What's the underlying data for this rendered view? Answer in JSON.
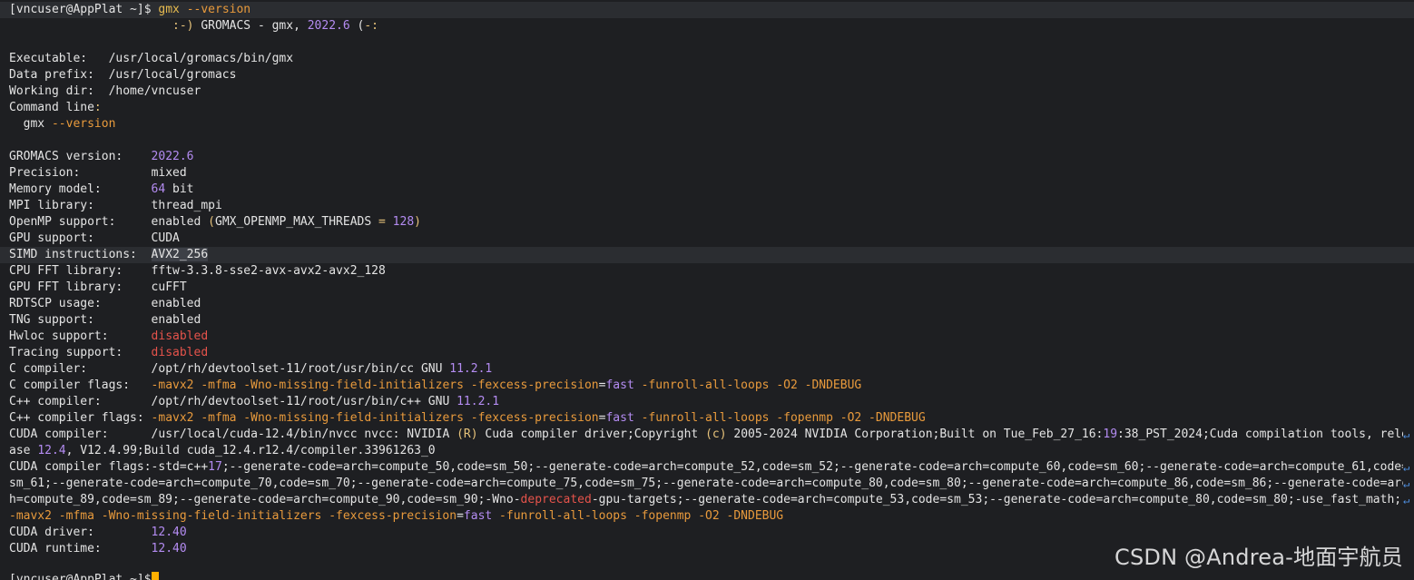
{
  "prompt": {
    "user_host": "[vncuser@AppPlat ~]$",
    "command": "gmx",
    "args": "--version"
  },
  "banner": {
    "smile_open": ":-)",
    "text": " GROMACS - gmx, ",
    "version": "2022.6",
    "smile_close_open": " (",
    "smile_close_tail": "-:"
  },
  "paths": {
    "executable_label": "Executable:",
    "executable_value": "/usr/local/gromacs/bin/gmx",
    "data_prefix_label": "Data prefix:",
    "data_prefix_value": "/usr/local/gromacs",
    "working_dir_label": "Working dir:",
    "working_dir_value": "/home/vncuser",
    "command_line_label": "Command line",
    "colon": ":",
    "command_line_cmd": "gmx",
    "command_line_args": "--version"
  },
  "info": {
    "gromacs_version_label": "GROMACS version:",
    "gromacs_version_value": "2022.6",
    "precision_label": "Precision:",
    "precision_value": "mixed",
    "memory_model_label": "Memory model:",
    "memory_model_num": "64",
    "memory_model_unit": " bit",
    "mpi_label": "MPI library:",
    "mpi_value": "thread_mpi",
    "openmp_label": "OpenMP support:",
    "openmp_value_a": "enabled ",
    "openmp_paren_open": "(",
    "openmp_value_b": "GMX_OPENMP_MAX_THREADS ",
    "openmp_eq": "=",
    "openmp_num": " 128",
    "openmp_paren_close": ")",
    "gpu_label": "GPU support:",
    "gpu_value": "CUDA",
    "simd_label": "SIMD instructions:",
    "simd_value": "AVX2_256",
    "cpu_fft_label": "CPU FFT library:",
    "cpu_fft_value": "fftw-3.3.8-sse2-avx-avx2-avx2_128",
    "gpu_fft_label": "GPU FFT library:",
    "gpu_fft_value": "cuFFT",
    "rdtscp_label": "RDTSCP usage:",
    "rdtscp_value": "enabled",
    "tng_label": "TNG support:",
    "tng_value": "enabled",
    "hwloc_label": "Hwloc support:",
    "hwloc_value": "disabled",
    "tracing_label": "Tracing support:",
    "tracing_value": "disabled",
    "c_compiler_label": "C compiler:",
    "c_compiler_value": "/opt/rh/devtoolset-11/root/usr/bin/cc GNU ",
    "c_compiler_ver": "11.2.1",
    "c_flags_label": "C compiler flags:",
    "c_flags_a": "-mavx2 -mfma -Wno-missing-field-initializers -fexcess-precision",
    "c_flags_eq": "=",
    "c_flags_fast": "fast",
    "c_flags_b": " -funroll-all-loops -O2 -DNDEBUG",
    "cxx_compiler_label": "C++ compiler:",
    "cxx_compiler_value": "/opt/rh/devtoolset-11/root/usr/bin/c++ GNU ",
    "cxx_compiler_ver": "11.2.1",
    "cxx_flags_label": "C++ compiler flags:",
    "cxx_flags_a": "-mavx2 -mfma -Wno-missing-field-initializers -fexcess-precision",
    "cxx_flags_eq": "=",
    "cxx_flags_fast": "fast",
    "cxx_flags_b": " -funroll-all-loops -fopenmp -O2 -DNDEBUG",
    "cuda_compiler_label": "CUDA compiler:",
    "cuda_compiler_line1_a": "/usr/local/cuda-12.4/bin/nvcc nvcc: NVIDIA ",
    "cuda_compiler_r": "(R)",
    "cuda_compiler_line1_b": " Cuda compiler driver",
    "semi": ";",
    "cuda_compiler_line1_c": "Copyright ",
    "cuda_compiler_c": "(c)",
    "cuda_compiler_line1_d": " 2005-2024 NVIDIA Corporation",
    "cuda_compiler_line1_e": "Built on Tue_Feb_27_16",
    "cuda_compiler_time_b": "19",
    "cuda_compiler_line1_f": ":38_PST_2024",
    "cuda_compiler_line1_g": "Cuda compilation tools, rele",
    "cuda_compiler_line2_a": "ase ",
    "cuda_compiler_line2_ver": "12.4",
    "cuda_compiler_line2_b": ", V12.4.99",
    "cuda_compiler_line2_c": "Build cuda_12.4.r12.4/compiler.33961263_0",
    "cuda_flags_label": "CUDA compiler flags:",
    "cuda_flags_l1_a": "-std=c++",
    "cuda_flags_l1_17": "17",
    "cuda_flags_l1_b": "--generate-code=arch=compute_50,code=sm_50",
    "cuda_flags_l1_c": "--generate-code=arch=compute_52,code=sm_52",
    "cuda_flags_l1_d": "--generate-code=arch=compute_60,code=sm_60",
    "cuda_flags_l1_e": "--generate-code=arch=compute_61,code=",
    "cuda_flags_l2_a": "sm_61",
    "cuda_flags_l2_b": "--generate-code=arch=compute_70,code=sm_70",
    "cuda_flags_l2_c": "--generate-code=arch=compute_75,code=sm_75",
    "cuda_flags_l2_d": "--generate-code=arch=compute_80,code=sm_80",
    "cuda_flags_l2_e": "--generate-code=arch=compute_86,code=sm_86",
    "cuda_flags_l2_f": "--generate-code=arc",
    "cuda_flags_l3_a": "h=compute_89,code=sm_89",
    "cuda_flags_l3_b": "--generate-code=arch=compute_90,code=sm_90",
    "cuda_flags_l3_c": "-Wno-",
    "cuda_flags_l3_dep": "deprecated",
    "cuda_flags_l3_d": "-gpu-targets",
    "cuda_flags_l3_e": "--generate-code=arch=compute_53,code=sm_53",
    "cuda_flags_l3_f": "--generate-code=arch=compute_80,code=sm_80",
    "cuda_flags_l3_g": "-use_fast_math",
    "cuda_flags_l3_h": ";",
    "cuda_flags_l4_a": "-mavx2 -mfma -Wno-missing-field-initializers -fexcess-precision",
    "cuda_flags_l4_eq": "=",
    "cuda_flags_l4_fast": "fast",
    "cuda_flags_l4_b": " -funroll-all-loops -fopenmp -O2 -DNDEBUG",
    "cuda_driver_label": "CUDA driver:",
    "cuda_driver_value": "12.40",
    "cuda_runtime_label": "CUDA runtime:",
    "cuda_runtime_value": "12.40"
  },
  "final_prompt": {
    "user_host": "[vncuser@AppPlat ~]$"
  },
  "watermark": "CSDN @Andrea-地面宇航员",
  "colors": {
    "background": "#1e1f22",
    "text": "#e4e4e4",
    "command": "#e5ba4f",
    "number": "#b48cf2",
    "disabled": "#e5534b",
    "cursor": "#ffb000"
  }
}
